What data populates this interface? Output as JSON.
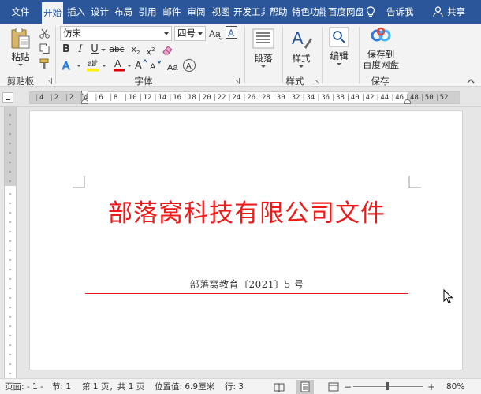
{
  "tabs": [
    {
      "label": "文件",
      "active": false
    },
    {
      "label": "开始",
      "active": true
    },
    {
      "label": "插入",
      "active": false
    },
    {
      "label": "设计",
      "active": false
    },
    {
      "label": "布局",
      "active": false
    },
    {
      "label": "引用",
      "active": false
    },
    {
      "label": "邮件",
      "active": false
    },
    {
      "label": "审阅",
      "active": false
    },
    {
      "label": "视图",
      "active": false
    },
    {
      "label": "开发工具",
      "active": false
    },
    {
      "label": "帮助",
      "active": false
    },
    {
      "label": "特色功能",
      "active": false
    },
    {
      "label": "百度网盘",
      "active": false
    }
  ],
  "tell_me": "告诉我",
  "share": "共享",
  "ribbon": {
    "clipboard": {
      "paste": "粘贴",
      "group": "剪贴板"
    },
    "font": {
      "name": "仿宋",
      "size": "四号",
      "group": "字体"
    },
    "paragraph": {
      "label": "段落"
    },
    "styles": {
      "label": "样式",
      "group": "样式"
    },
    "editing": {
      "label": "编辑"
    },
    "save": {
      "label_line1": "保存到",
      "label_line2": "百度网盘",
      "group": "保存"
    }
  },
  "ruler_ticks": [
    "4",
    "2",
    "2",
    "4",
    "6",
    "8",
    "10",
    "12",
    "14",
    "16",
    "18",
    "20",
    "22",
    "24",
    "26",
    "28",
    "30",
    "32",
    "34",
    "36",
    "38",
    "40",
    "42",
    "44",
    "46",
    "48",
    "50",
    "52"
  ],
  "document": {
    "title": "部落窝科技有限公司文件",
    "doc_number": "部落窝教育〔2021〕5 号",
    "title_color": "#ee1a1a",
    "rule_color": "#ee1a1a"
  },
  "status": {
    "page_field": "页面: - 1 -",
    "section": "节: 1",
    "pages": "第 1 页，共 1 页",
    "position": "位置值: 6.9厘米",
    "line": "行: 3",
    "zoom": "80%"
  },
  "colors": {
    "accent": "#2b579a",
    "ribbon_bg": "#f3f3f3"
  }
}
